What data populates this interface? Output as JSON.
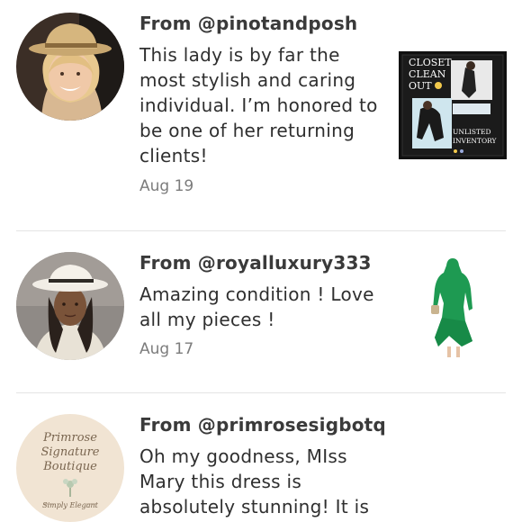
{
  "reviews": [
    {
      "from_prefix": "From ",
      "handle": "@pinotandposh",
      "message": "This lady is by far the most stylish and caring individual. I’m honored to be one of her returning clients!",
      "date": "Aug 19",
      "listing": {
        "lines": [
          "CLOSET",
          "CLEAN",
          "OUT"
        ],
        "sub_lines": [
          "UNLISTED",
          "INVENTORY"
        ]
      }
    },
    {
      "from_prefix": "From ",
      "handle": "@royalluxury333",
      "message": "Amazing condition ! Love all my pieces !",
      "date": "Aug 17"
    },
    {
      "from_prefix": "From ",
      "handle": "@primrosesigbotq",
      "message": "Oh my goodness, MIss Mary this dress is absolutely stunning! It is",
      "avatar_logo": {
        "line1": "Primrose",
        "line2": "Signature",
        "line3": "Boutique",
        "tagline": "Simply Elegant"
      }
    }
  ]
}
